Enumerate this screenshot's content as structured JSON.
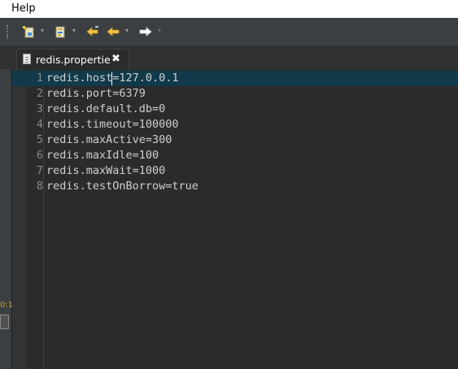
{
  "menu": {
    "help_label": "Help"
  },
  "toolbar": {
    "buttons": [
      {
        "name": "new-wizard-icon"
      },
      {
        "name": "open-type-icon"
      },
      {
        "name": "last-edit-location-icon"
      },
      {
        "name": "back-icon"
      },
      {
        "name": "forward-icon"
      }
    ]
  },
  "editor": {
    "tab_title": "redis.propertie",
    "lines": [
      {
        "num": "1",
        "text": "redis.host=127.0.0.1"
      },
      {
        "num": "2",
        "text": "redis.port=6379"
      },
      {
        "num": "3",
        "text": "redis.default.db=0"
      },
      {
        "num": "4",
        "text": "redis.timeout=100000"
      },
      {
        "num": "5",
        "text": "redis.maxActive=300"
      },
      {
        "num": "6",
        "text": "redis.maxIdle=100"
      },
      {
        "num": "7",
        "text": "redis.maxWait=1000"
      },
      {
        "num": "8",
        "text": "redis.testOnBorrow=true"
      }
    ]
  },
  "side": {
    "label": "0:1"
  },
  "colors": {
    "current_line": "#113a4a",
    "editor_bg": "#2b2b2b",
    "toolbar_bg": "#3c3f41"
  }
}
